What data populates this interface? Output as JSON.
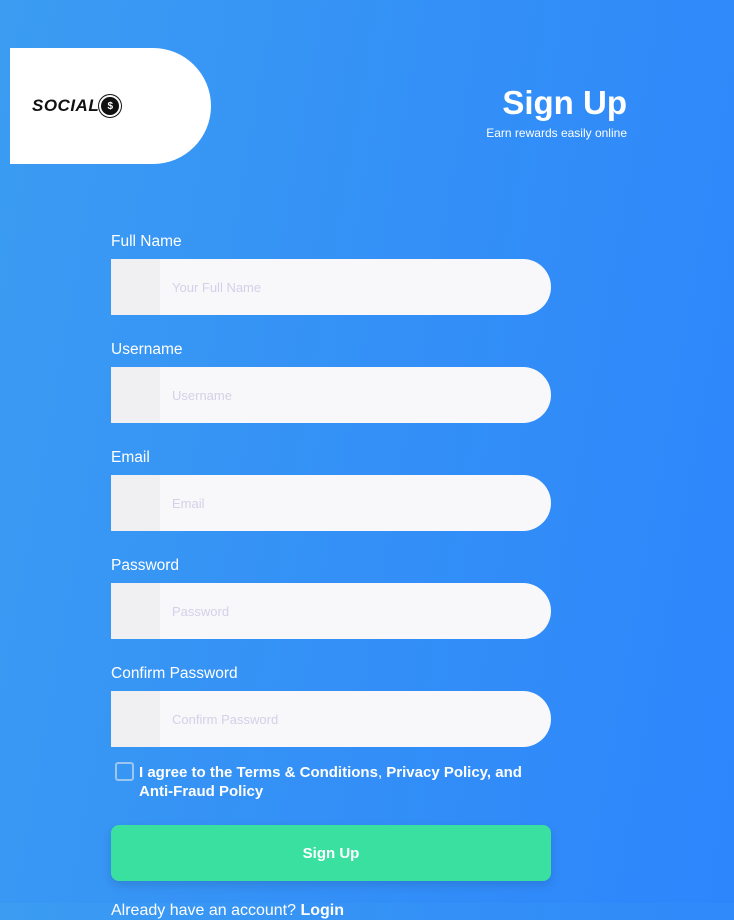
{
  "logo": {
    "text": "SOCIAL",
    "coin": "$"
  },
  "header": {
    "title": "Sign Up",
    "subtitle": "Earn rewards easily online"
  },
  "fields": [
    {
      "label": "Full Name",
      "placeholder": "Your Full Name",
      "value": ""
    },
    {
      "label": "Username",
      "placeholder": "Username",
      "value": ""
    },
    {
      "label": "Email",
      "placeholder": "Email",
      "value": ""
    },
    {
      "label": "Password",
      "placeholder": "Password",
      "value": ""
    },
    {
      "label": "Confirm Password",
      "placeholder": "Confirm Password",
      "value": ""
    }
  ],
  "agree": {
    "prefix": "I agree to the ",
    "terms": "Terms & Conditions",
    "comma": ", ",
    "privacy": "Privacy Policy",
    "and": ", and ",
    "fraud": "Anti-Fraud Policy",
    "checked": false
  },
  "submit_label": "Sign Up",
  "login": {
    "prompt": "Already have an account? ",
    "link": "Login"
  },
  "colors": {
    "button": "#3ae0a0",
    "background": "#3490f6"
  }
}
